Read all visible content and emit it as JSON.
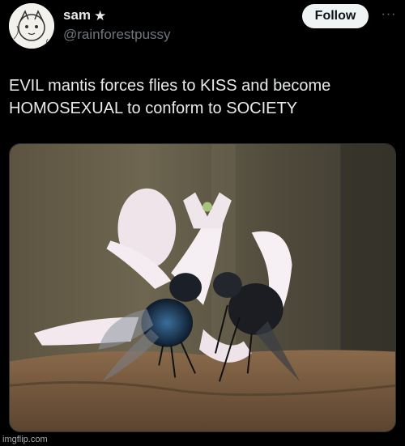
{
  "author": {
    "display_name": "sam",
    "badge_icon": "star-icon",
    "badge_glyph": "★",
    "handle": "@rainforestpussy"
  },
  "actions": {
    "follow_label": "Follow",
    "more_icon": "more-horizontal-icon",
    "more_glyph": "···"
  },
  "tweet": {
    "line1": "EVIL mantis forces flies to KISS and become",
    "line2": "HOMOSEXUAL to conform to SOCIETY"
  },
  "media": {
    "kind": "photo",
    "subject_icon": "mantis-and-flies-photo"
  },
  "watermark": "imgflip.com",
  "colors": {
    "background": "#000000",
    "text": "#e7e9ea",
    "muted": "#71767b",
    "follow_bg": "#eff3f4"
  }
}
